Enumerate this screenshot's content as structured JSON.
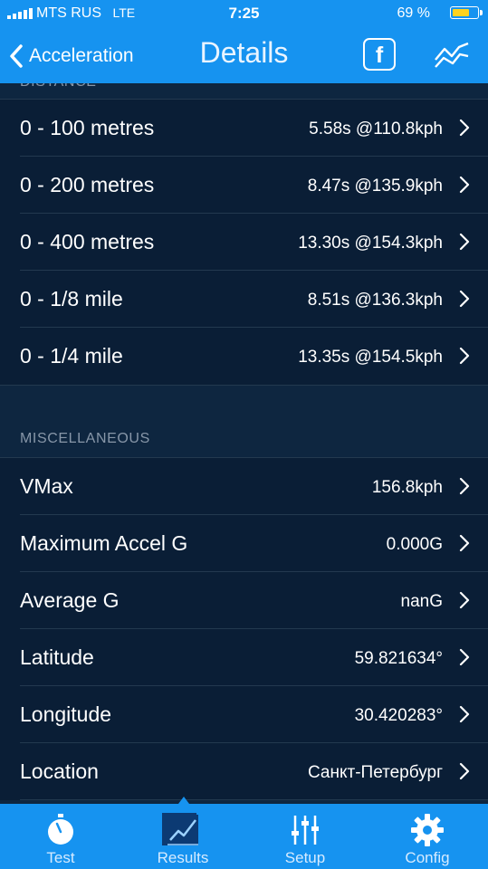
{
  "status_bar": {
    "carrier": "MTS RUS",
    "network": "LTE",
    "time": "7:25",
    "battery_percent": "69 %"
  },
  "nav": {
    "back_label": "Acceleration",
    "title": "Details",
    "facebook_icon": "facebook-icon",
    "chart_icon": "chart-line-icon"
  },
  "sections": {
    "distance": {
      "header": "DISTANCE",
      "rows": [
        {
          "label": "0 - 100 metres",
          "value": "5.58s @110.8kph"
        },
        {
          "label": "0 - 200 metres",
          "value": "8.47s @135.9kph"
        },
        {
          "label": "0 - 400 metres",
          "value": "13.30s @154.3kph"
        },
        {
          "label": "0 - 1/8 mile",
          "value": "8.51s @136.3kph"
        },
        {
          "label": "0 - 1/4 mile",
          "value": "13.35s @154.5kph"
        }
      ]
    },
    "misc": {
      "header": "MISCELLANEOUS",
      "rows": [
        {
          "label": "VMax",
          "value": "156.8kph"
        },
        {
          "label": "Maximum Accel G",
          "value": "0.000G"
        },
        {
          "label": "Average G",
          "value": "nanG"
        },
        {
          "label": "Latitude",
          "value": "59.821634°"
        },
        {
          "label": "Longitude",
          "value": "30.420283°"
        },
        {
          "label": "Location",
          "value": "Санкт-Петербург"
        }
      ]
    }
  },
  "tabbar": {
    "tabs": [
      {
        "label": "Test",
        "icon": "stopwatch-icon"
      },
      {
        "label": "Results",
        "icon": "results-chart-icon",
        "active": true
      },
      {
        "label": "Setup",
        "icon": "sliders-icon"
      },
      {
        "label": "Config",
        "icon": "gear-icon"
      }
    ]
  },
  "colors": {
    "accent": "#1693f0",
    "background": "#0e2640",
    "row_background": "#0a1e36",
    "battery": "#ffd21e"
  }
}
